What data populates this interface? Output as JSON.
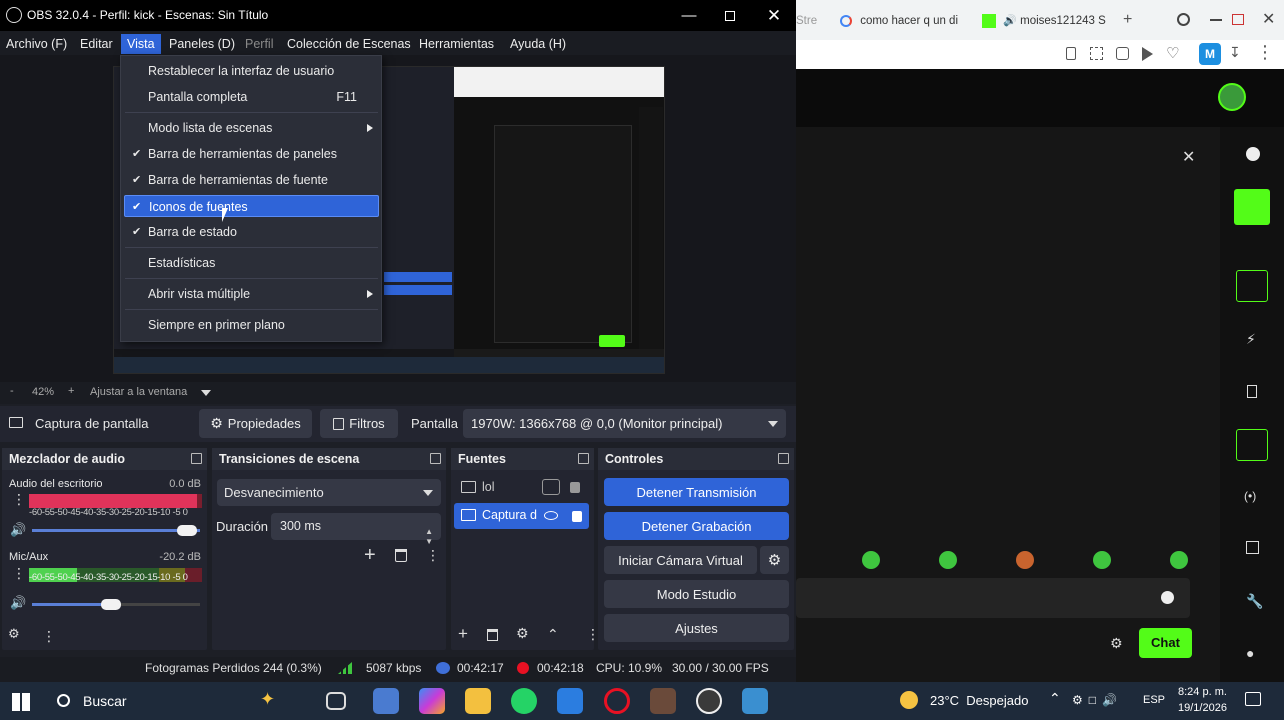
{
  "obs": {
    "title": "OBS 32.0.4 - Perfil: kick - Escenas: Sin Título",
    "menubar": [
      "Archivo (F)",
      "Editar",
      "Vista",
      "Paneles (D)",
      "Perfil",
      "Colección de Escenas",
      "Herramientas",
      "Ayuda (H)"
    ],
    "vista_menu": {
      "items": [
        {
          "label": "Restablecer la interfaz de usuario",
          "checked": false
        },
        {
          "label": "Pantalla completa",
          "shortcut": "F11",
          "checked": false
        },
        {
          "label": "Modo lista de escenas",
          "submenu": true,
          "checked": false
        },
        {
          "label": "Barra de herramientas de paneles",
          "checked": true
        },
        {
          "label": "Barra de herramientas de fuente",
          "checked": true
        },
        {
          "label": "Iconos de fuentes",
          "checked": true,
          "highlighted": true
        },
        {
          "label": "Barra de estado",
          "checked": true
        },
        {
          "label": "Estadísticas",
          "checked": false
        },
        {
          "label": "Abrir vista múltiple",
          "submenu": true,
          "checked": false
        },
        {
          "label": "Siempre en primer plano",
          "checked": false
        }
      ]
    },
    "zoom": {
      "minus": "-",
      "value": "42%",
      "plus": "+",
      "fit": "Ajustar a la ventana"
    },
    "source_toolbar": {
      "source_name": "Captura de pantalla",
      "properties": "Propiedades",
      "filters": "Filtros",
      "display_label": "Pantalla",
      "display_value": "1970W: 1366x768 @ 0,0 (Monitor principal)"
    },
    "mixer": {
      "title": "Mezclador de audio",
      "tracks": [
        {
          "name": "Audio del escritorio",
          "db": "0.0 dB",
          "level": 0.97,
          "scale": "-60-55-50-45-40-35-30-25-20-15-10 -5  0"
        },
        {
          "name": "Mic/Aux",
          "db": "-20.2 dB",
          "level": 0.52,
          "scale": "-60-55-50-45-40-35-30-25-20-15-10 -5  0"
        }
      ]
    },
    "transitions": {
      "title": "Transiciones de escena",
      "selected": "Desvanecimiento",
      "duration_label": "Duración",
      "duration_value": "300 ms"
    },
    "sources": {
      "title": "Fuentes",
      "items": [
        {
          "name": "lol",
          "selected": false
        },
        {
          "name": "Captura d",
          "selected": true
        }
      ]
    },
    "controls": {
      "title": "Controles",
      "stop_stream": "Detener Transmisión",
      "stop_record": "Detener Grabación",
      "virtual_cam": "Iniciar Cámara Virtual",
      "studio_mode": "Modo Estudio",
      "settings": "Ajustes"
    },
    "status": {
      "dropped": "Fotogramas Perdidos 244 (0.3%)",
      "bitrate": "5087 kbps",
      "stream_time": "00:42:17",
      "rec_time": "00:42:18",
      "cpu": "CPU: 10.9%",
      "fps": "30.00 / 30.00 FPS"
    }
  },
  "browser": {
    "tabs": [
      "Stre",
      "como hacer q un di",
      "moises121243 S"
    ],
    "profile_letter": "M",
    "chat_button": "Chat"
  },
  "taskbar": {
    "search": "Buscar",
    "weather": "23°C  Despejado",
    "lang": "ESP",
    "time": "8:24 p. m.",
    "date": "19/1/2026"
  },
  "colors": {
    "accent_blue": "#2f64d8",
    "kick_green": "#53fc18",
    "rec_red": "#e81123"
  }
}
